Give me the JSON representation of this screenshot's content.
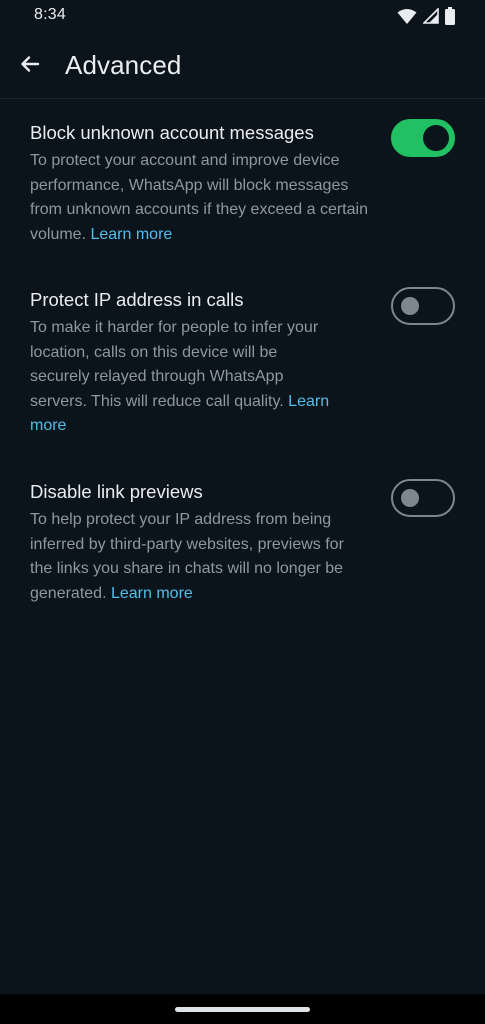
{
  "status_bar": {
    "time": "8:34",
    "icons": [
      "wifi-icon",
      "cellular-signal-icon",
      "battery-icon"
    ]
  },
  "app_bar": {
    "back_icon": "arrow-left-icon",
    "title": "Advanced"
  },
  "settings": [
    {
      "title": "Block unknown account messages",
      "description": "To protect your account and improve device performance, WhatsApp will block messages from unknown accounts if they exceed a certain volume.",
      "link": "Learn more",
      "enabled": true
    },
    {
      "title": "Protect IP address in calls",
      "description": "To make it harder for people to infer your location, calls on this device will be securely relayed through WhatsApp servers. This will reduce call quality.",
      "link": "Learn more",
      "enabled": false
    },
    {
      "title": "Disable link previews",
      "description": "To help protect your IP address from being inferred by third-party websites, previews for the links you share in chats will no longer be generated.",
      "link": "Learn more",
      "enabled": false
    }
  ],
  "colors": {
    "background": "#0b141a",
    "toggle_on": "#21c063",
    "link": "#53bdeb",
    "secondary_text": "#8d989f"
  }
}
